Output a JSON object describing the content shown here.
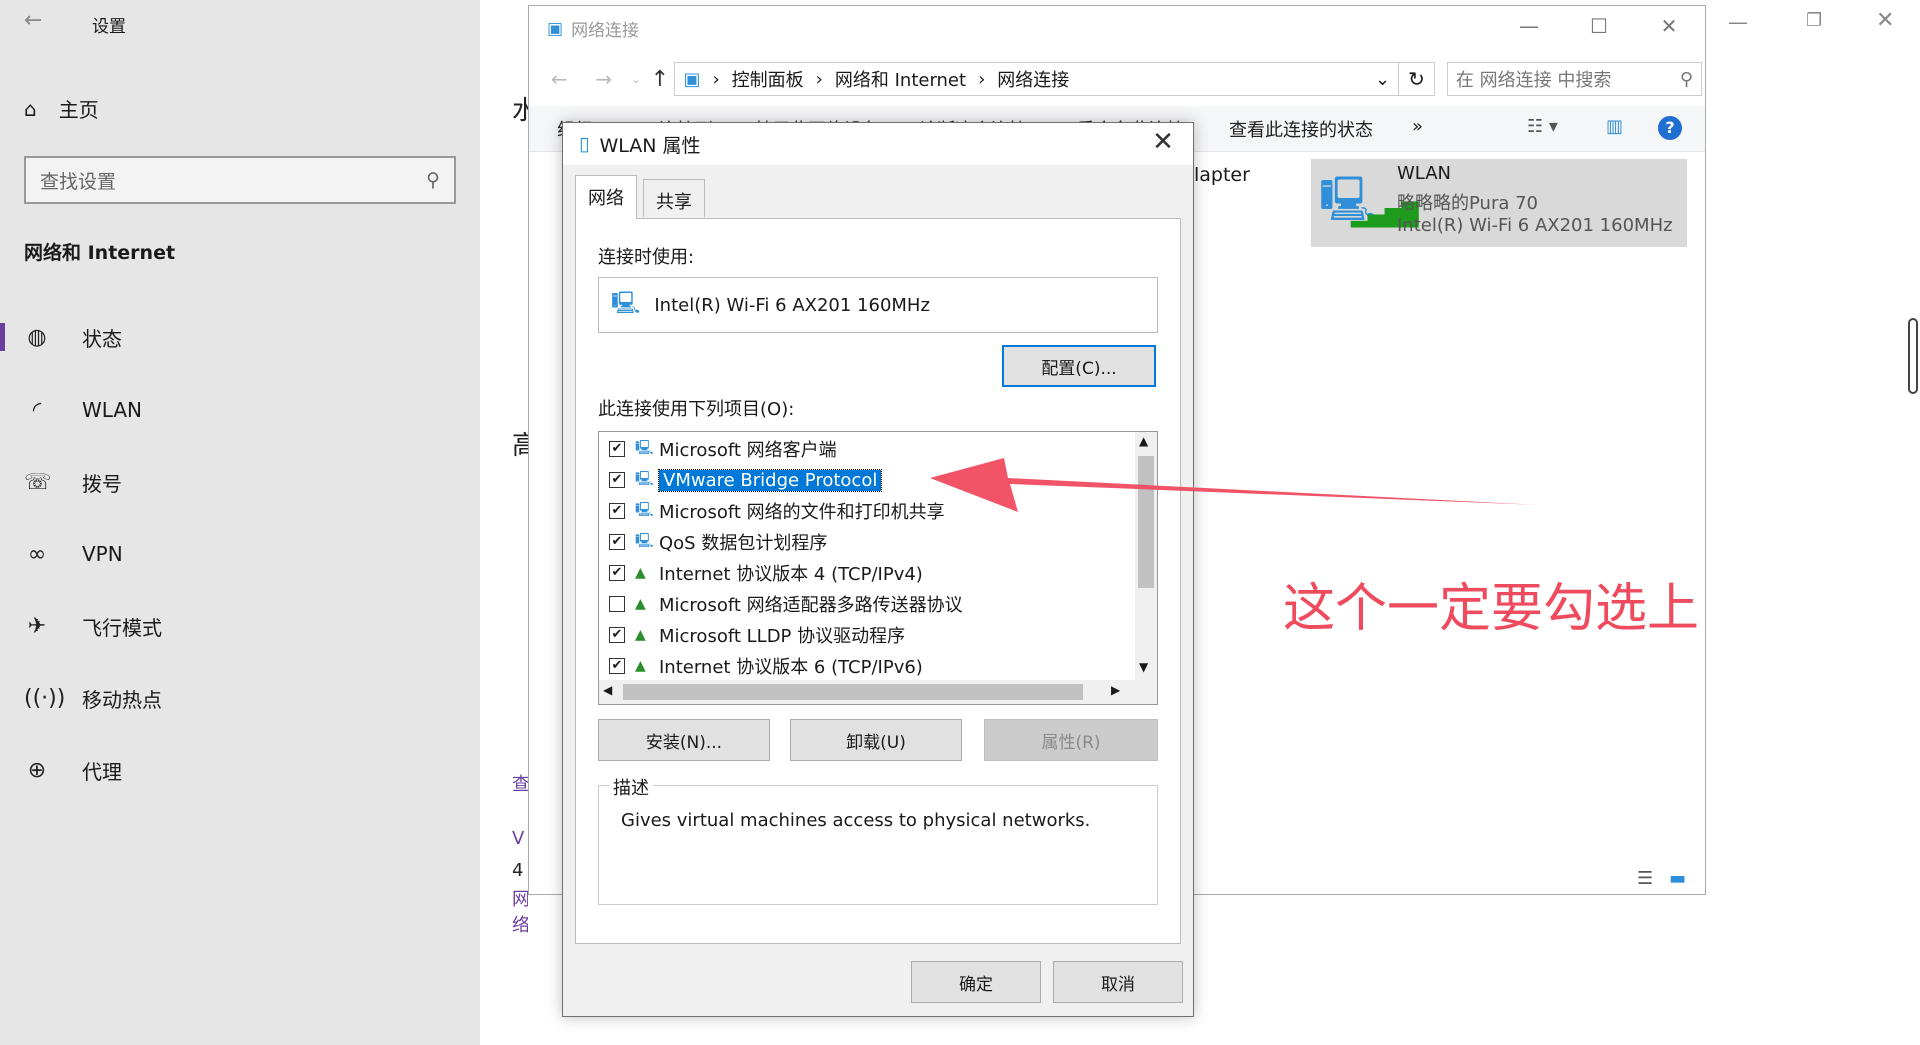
{
  "settings": {
    "title": "设置",
    "home": "主页",
    "search_placeholder": "查找设置",
    "section": "网络和 Internet",
    "nav": [
      {
        "label": "状态",
        "icon": "globe-status-icon"
      },
      {
        "label": "WLAN",
        "icon": "wifi-icon"
      },
      {
        "label": "拨号",
        "icon": "dialup-icon"
      },
      {
        "label": "VPN",
        "icon": "vpn-icon"
      },
      {
        "label": "飞行模式",
        "icon": "airplane-icon"
      },
      {
        "label": "移动热点",
        "icon": "hotspot-icon"
      },
      {
        "label": "代理",
        "icon": "globe-icon"
      }
    ],
    "fragments": [
      "水",
      "高",
      "4",
      "查",
      "V",
      "网络"
    ]
  },
  "explorer": {
    "title": "网络连接",
    "breadcrumb": [
      "控制面板",
      "网络和 Internet",
      "网络连接"
    ],
    "search_placeholder": "在 网络连接 中搜索",
    "commands": [
      "组织",
      "连接到",
      "禁用此网络设备",
      "诊断这个连接",
      "重命名此连接",
      "查看此连接的状态",
      "»"
    ],
    "adapter_fragment": "lapter",
    "wlan_tile": {
      "name": "WLAN",
      "ssid": "略略略的Pura 70",
      "device": "Intel(R) Wi-Fi 6 AX201 160MHz"
    }
  },
  "dialog": {
    "title": "WLAN 属性",
    "tabs": [
      "网络",
      "共享"
    ],
    "connect_using_label": "连接时使用:",
    "adapter_name": "Intel(R) Wi-Fi 6 AX201 160MHz",
    "configure_button": "配置(C)...",
    "items_label": "此连接使用下列项目(O):",
    "items": [
      {
        "label": "Microsoft 网络客户端",
        "checked": true,
        "icon": "network-client-icon"
      },
      {
        "label": "VMware Bridge Protocol",
        "checked": true,
        "icon": "network-client-icon",
        "selected": true
      },
      {
        "label": "Microsoft 网络的文件和打印机共享",
        "checked": true,
        "icon": "network-client-icon"
      },
      {
        "label": "QoS 数据包计划程序",
        "checked": true,
        "icon": "network-client-icon"
      },
      {
        "label": "Internet 协议版本 4 (TCP/IPv4)",
        "checked": true,
        "icon": "protocol-icon"
      },
      {
        "label": "Microsoft 网络适配器多路传送器协议",
        "checked": false,
        "icon": "protocol-icon"
      },
      {
        "label": "Microsoft LLDP 协议驱动程序",
        "checked": true,
        "icon": "protocol-icon"
      },
      {
        "label": "Internet 协议版本 6 (TCP/IPv6)",
        "checked": true,
        "icon": "protocol-icon"
      }
    ],
    "install_button": "安装(N)...",
    "uninstall_button": "卸载(U)",
    "properties_button": "属性(R)",
    "description_label": "描述",
    "description_text": "Gives virtual machines access to physical networks.",
    "ok_button": "确定",
    "cancel_button": "取消"
  },
  "annotation": {
    "note": "这个一定要勾选上",
    "color": "#ef4b5e"
  }
}
